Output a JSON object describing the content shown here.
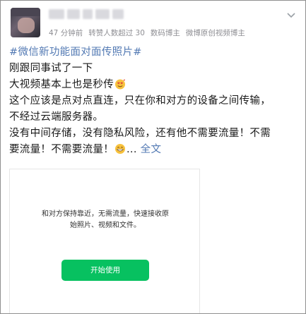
{
  "header": {
    "meta": {
      "time": "47 分钟前",
      "repost": "转赞人数超过 30",
      "tag1": "数码博主",
      "tag2": "微博原创视频博主"
    }
  },
  "post": {
    "hashtag": "#微信新功能面对面传照片#",
    "line1": "刚跟同事试了一下",
    "line2": "大视频基本上也是秒传",
    "line3": "这个应该是点对点直连，只在你和对方的设备之间传输，",
    "line4": "不经过云端服务器。",
    "line5": "没有中间存储，没有隐私风险，还有他不需要流量！不需",
    "line6a": "要流量！不需要流量！",
    "line6b": "... ",
    "more": "全文"
  },
  "card": {
    "text_line1": "和对方保持靠近，无需流量，快速接收原",
    "text_line2": "始照片、视频和文件。",
    "button": "开始使用",
    "button_color": "#07c160"
  },
  "icons": {
    "more": "chevron-down-icon",
    "emoji1": "heart-eyes-emoji-icon",
    "emoji2": "grin-emoji-icon"
  }
}
